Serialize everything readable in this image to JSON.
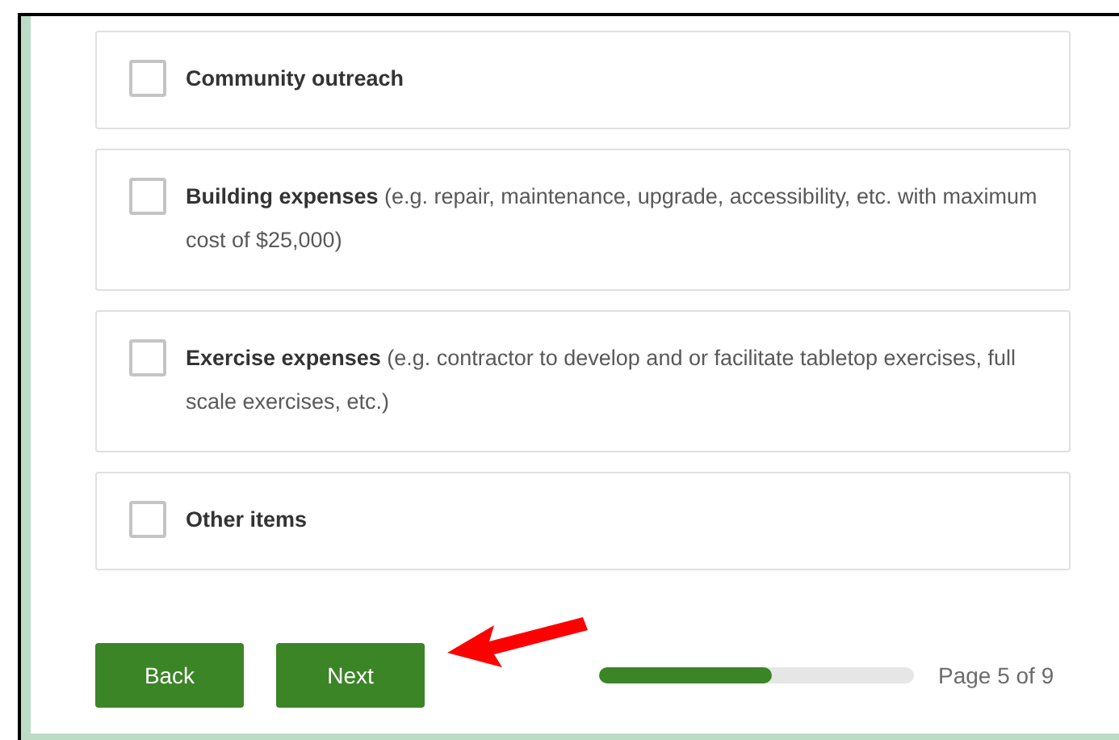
{
  "options": [
    {
      "text": "**Community outreach**",
      "checked": false
    },
    {
      "text": "**Building expenses** (e.g. repair, maintenance, upgrade, accessibility, etc. with maximum cost of $25,000)",
      "checked": false
    },
    {
      "text": "**Exercise expenses** (e.g. contractor to develop and or facilitate tabletop exercises, full scale exercises, etc.)",
      "checked": false
    },
    {
      "text": "**Other items**",
      "checked": false
    }
  ],
  "buttons": [
    "Back",
    "Next"
  ],
  "progress": {
    "level": 0.55,
    "label": "Page 5 of 9"
  }
}
